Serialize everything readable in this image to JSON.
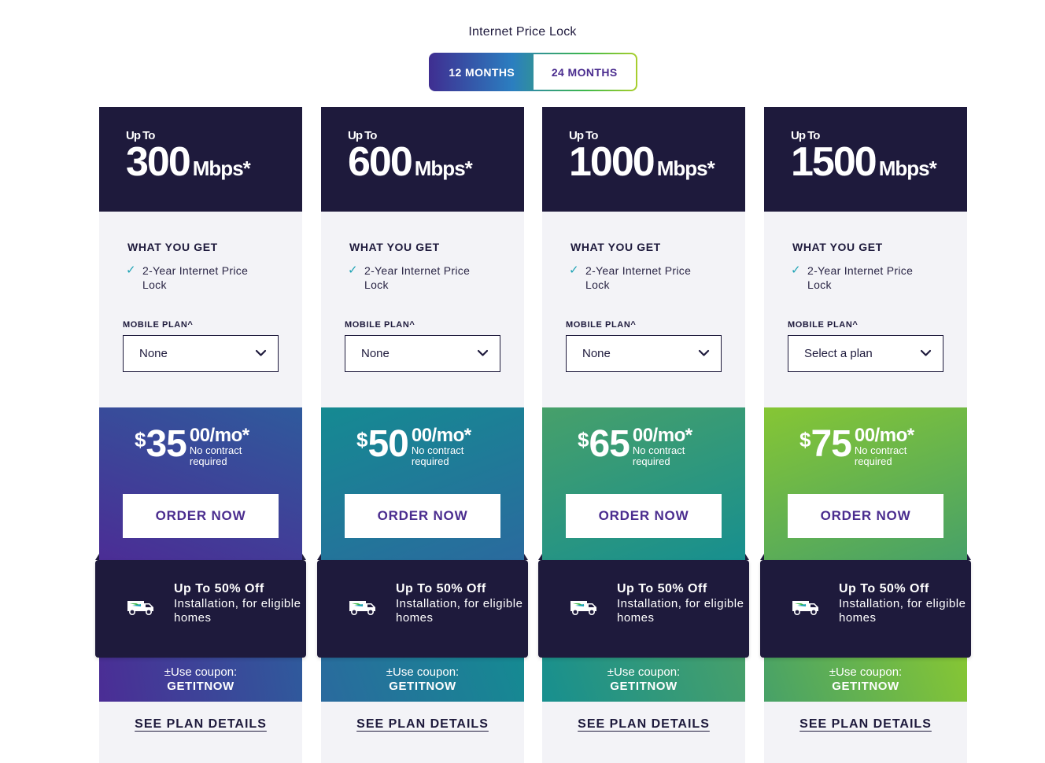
{
  "header": {
    "title": "Internet Price Lock",
    "toggle": {
      "option_12": "12 MONTHS",
      "option_24": "24 MONTHS",
      "selected": "12 MONTHS"
    }
  },
  "colors": {
    "navy": "#1e1a3c",
    "purple": "#4b2d8f",
    "check_teal": "#1ea3b5",
    "card_bg": "#f3f3f7"
  },
  "plans": [
    {
      "upto": "Up To",
      "speed": "300",
      "unit": "Mbps*",
      "what_you_get": "WHAT YOU GET",
      "feature": "2-Year Internet Price Lock",
      "mobile_plan_label": "MOBILE PLAN^",
      "mobile_plan_value": "None",
      "dollar": "$",
      "price": "35",
      "cents": "00/mo*",
      "no_contract": "No contract required",
      "order_label": "ORDER NOW",
      "promo_title": "Up To 50% Off",
      "promo_text": "Installation, for eligible homes",
      "coupon_label": "±Use coupon:",
      "coupon_code": "GETITNOW",
      "details_label": "SEE PLAN DETAILS",
      "gradient": [
        "#4b2d95",
        "#2e5b9c"
      ]
    },
    {
      "upto": "Up To",
      "speed": "600",
      "unit": "Mbps*",
      "what_you_get": "WHAT YOU GET",
      "feature": "2-Year Internet Price Lock",
      "mobile_plan_label": "MOBILE PLAN^",
      "mobile_plan_value": "None",
      "dollar": "$",
      "price": "50",
      "cents": "00/mo*",
      "no_contract": "No contract required",
      "order_label": "ORDER NOW",
      "promo_title": "Up To 50% Off",
      "promo_text": "Installation, for eligible homes",
      "coupon_label": "±Use coupon:",
      "coupon_code": "GETITNOW",
      "details_label": "SEE PLAN DETAILS",
      "gradient": [
        "#2a6a9e",
        "#158a92"
      ]
    },
    {
      "upto": "Up To",
      "speed": "1000",
      "unit": "Mbps*",
      "what_you_get": "WHAT YOU GET",
      "feature": "2-Year Internet Price Lock",
      "mobile_plan_label": "MOBILE PLAN^",
      "mobile_plan_value": "None",
      "dollar": "$",
      "price": "65",
      "cents": "00/mo*",
      "no_contract": "No contract required",
      "order_label": "ORDER NOW",
      "promo_title": "Up To 50% Off",
      "promo_text": "Installation, for eligible homes",
      "coupon_label": "±Use coupon:",
      "coupon_code": "GETITNOW",
      "details_label": "SEE PLAN DETAILS",
      "gradient": [
        "#178f8f",
        "#47a06a"
      ]
    },
    {
      "upto": "Up To",
      "speed": "1500",
      "unit": "Mbps*",
      "what_you_get": "WHAT YOU GET",
      "feature": "2-Year Internet Price Lock",
      "mobile_plan_label": "MOBILE PLAN^",
      "mobile_plan_value": "Select a plan",
      "dollar": "$",
      "price": "75",
      "cents": "00/mo*",
      "no_contract": "No contract required",
      "order_label": "ORDER NOW",
      "promo_title": "Up To 50% Off",
      "promo_text": "Installation, for eligible homes",
      "coupon_label": "±Use coupon:",
      "coupon_code": "GETITNOW",
      "details_label": "SEE PLAN DETAILS",
      "gradient": [
        "#47a168",
        "#86c634"
      ]
    }
  ],
  "icons": {
    "check": "check-icon",
    "chevron": "chevron-down-icon",
    "van": "install-van-icon"
  }
}
